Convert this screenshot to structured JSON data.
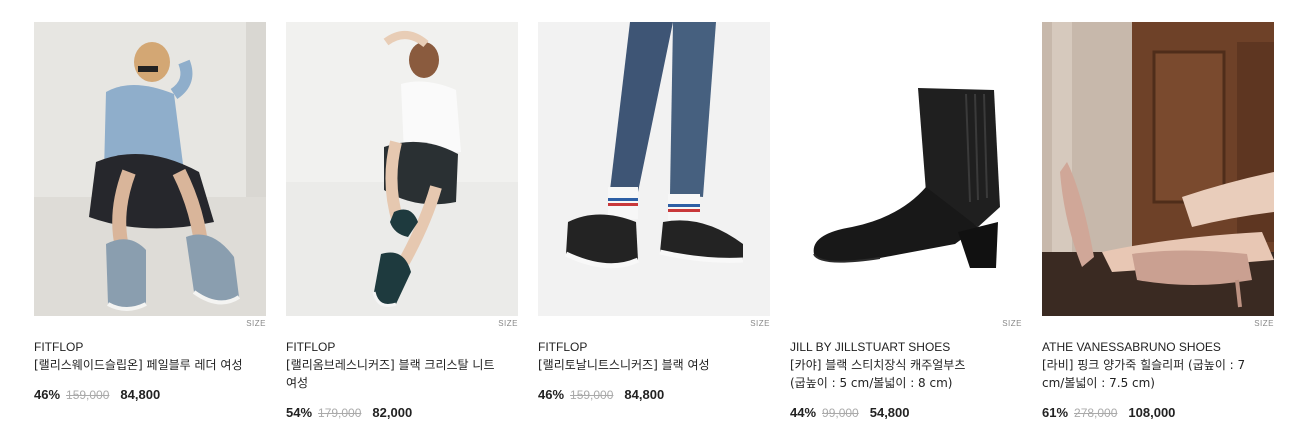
{
  "products": [
    {
      "size_label": "SIZE",
      "brand": "FITFLOP",
      "name": "[랠리스웨이드슬립온] 페일블루 레더 여성",
      "discount": "46%",
      "original_price": "159,000",
      "sale_price": "84,800"
    },
    {
      "size_label": "SIZE",
      "brand": "FITFLOP",
      "name": "[랠리옴브레스니커즈] 블랙 크리스탈 니트 여성",
      "discount": "54%",
      "original_price": "179,000",
      "sale_price": "82,000"
    },
    {
      "size_label": "SIZE",
      "brand": "FITFLOP",
      "name": "[랠리토날니트스니커즈] 블랙 여성",
      "discount": "46%",
      "original_price": "159,000",
      "sale_price": "84,800"
    },
    {
      "size_label": "SIZE",
      "brand": "JILL BY JILLSTUART SHOES",
      "name": "[카야] 블랙 스티치장식 캐주얼부츠 (굽높이 : 5 cm/볼넓이 : 8 cm)",
      "discount": "44%",
      "original_price": "99,000",
      "sale_price": "54,800"
    },
    {
      "size_label": "SIZE",
      "brand": "ATHE VANESSABRUNO SHOES",
      "name": "[라비] 핑크 양가죽 힐슬리퍼 (굽높이 : 7 cm/볼넓이 : 7.5 cm)",
      "discount": "61%",
      "original_price": "278,000",
      "sale_price": "108,000"
    }
  ]
}
